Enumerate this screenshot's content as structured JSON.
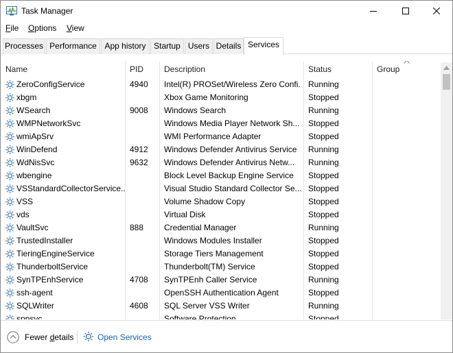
{
  "window": {
    "title": "Task Manager"
  },
  "menu": [
    {
      "label": "File",
      "accel": "F",
      "rest": "ile"
    },
    {
      "label": "Options",
      "accel": "O",
      "rest": "ptions"
    },
    {
      "label": "View",
      "accel": "V",
      "rest": "iew"
    }
  ],
  "tabs": [
    {
      "label": "Processes",
      "active": false
    },
    {
      "label": "Performance",
      "active": false
    },
    {
      "label": "App history",
      "active": false
    },
    {
      "label": "Startup",
      "active": false
    },
    {
      "label": "Users",
      "active": false
    },
    {
      "label": "Details",
      "active": false
    },
    {
      "label": "Services",
      "active": true
    }
  ],
  "table": {
    "columns": [
      "Name",
      "PID",
      "Description",
      "Status",
      "Group"
    ],
    "sorted_column": "Group",
    "rows": [
      {
        "name": "ZeroConfigService",
        "pid": "4940",
        "description": "Intel(R) PROSet/Wireless Zero Confi...",
        "status": "Running"
      },
      {
        "name": "xbgm",
        "pid": "",
        "description": "Xbox Game Monitoring",
        "status": "Stopped"
      },
      {
        "name": "WSearch",
        "pid": "9008",
        "description": "Windows Search",
        "status": "Running"
      },
      {
        "name": "WMPNetworkSvc",
        "pid": "",
        "description": "Windows Media Player Network Sh...",
        "status": "Stopped"
      },
      {
        "name": "wmiApSrv",
        "pid": "",
        "description": "WMI Performance Adapter",
        "status": "Stopped"
      },
      {
        "name": "WinDefend",
        "pid": "4912",
        "description": "Windows Defender Antivirus Service",
        "status": "Running"
      },
      {
        "name": "WdNisSvc",
        "pid": "9632",
        "description": "Windows Defender Antivirus Netw...",
        "status": "Running"
      },
      {
        "name": "wbengine",
        "pid": "",
        "description": "Block Level Backup Engine Service",
        "status": "Stopped"
      },
      {
        "name": "VSStandardCollectorService...",
        "pid": "",
        "description": "Visual Studio Standard Collector Se...",
        "status": "Stopped"
      },
      {
        "name": "VSS",
        "pid": "",
        "description": "Volume Shadow Copy",
        "status": "Stopped"
      },
      {
        "name": "vds",
        "pid": "",
        "description": "Virtual Disk",
        "status": "Stopped"
      },
      {
        "name": "VaultSvc",
        "pid": "888",
        "description": "Credential Manager",
        "status": "Running"
      },
      {
        "name": "TrustedInstaller",
        "pid": "",
        "description": "Windows Modules Installer",
        "status": "Stopped"
      },
      {
        "name": "TieringEngineService",
        "pid": "",
        "description": "Storage Tiers Management",
        "status": "Stopped"
      },
      {
        "name": "ThunderboltService",
        "pid": "",
        "description": "Thunderbolt(TM) Service",
        "status": "Stopped"
      },
      {
        "name": "SynTPEnhService",
        "pid": "4708",
        "description": "SynTPEnh Caller Service",
        "status": "Running"
      },
      {
        "name": "ssh-agent",
        "pid": "",
        "description": "OpenSSH Authentication Agent",
        "status": "Stopped"
      },
      {
        "name": "SQLWriter",
        "pid": "4608",
        "description": "SQL Server VSS Writer",
        "status": "Running"
      },
      {
        "name": "sppsvc",
        "pid": "",
        "description": "Software Protection",
        "status": "Stopped"
      }
    ]
  },
  "footer": {
    "fewer_details": {
      "accel": "",
      "pre": "Fewer ",
      "u": "d",
      "post": "etails"
    },
    "open_services": "Open Services"
  },
  "colors": {
    "link": "#1a5fb4",
    "icon_gear": "#4a7fb5"
  }
}
